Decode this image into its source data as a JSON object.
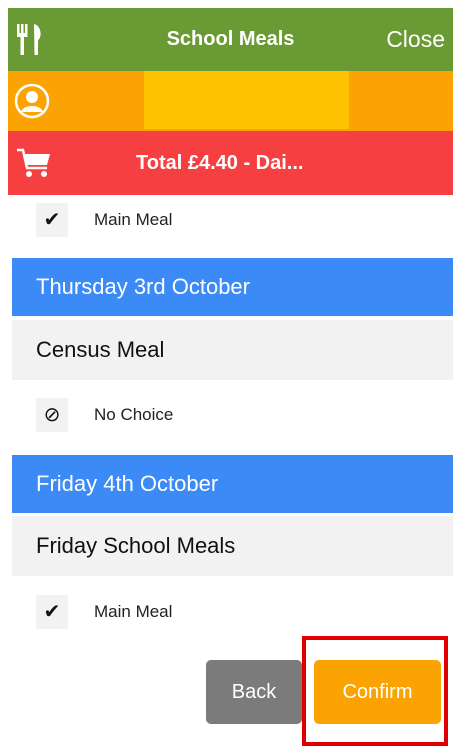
{
  "header": {
    "title": "School Meals",
    "close_label": "Close",
    "icon": "cutlery-icon"
  },
  "user_bar": {
    "icon": "user-avatar-icon",
    "name": ""
  },
  "basket": {
    "icon": "cart-icon",
    "total_text": "Total £4.40 - Dai..."
  },
  "days": [
    {
      "day": "",
      "meal_type": "",
      "selection": {
        "mark": "✔",
        "label": "Main Meal"
      }
    },
    {
      "day": "Thursday 3rd October",
      "meal_type": "Census Meal",
      "selection": {
        "mark": "⊘",
        "label": "No Choice"
      }
    },
    {
      "day": "Friday 4th October",
      "meal_type": "Friday School Meals",
      "selection": {
        "mark": "✔",
        "label": "Main Meal"
      }
    }
  ],
  "buttons": {
    "back": "Back",
    "confirm": "Confirm"
  },
  "colors": {
    "header": "#6a9a34",
    "user_bar": "#fba302",
    "name_box": "#fdc303",
    "basket": "#f63f41",
    "day_header": "#3b8af5",
    "confirm": "#fba302",
    "back": "#7b7b7b",
    "highlight": "#e00000"
  }
}
